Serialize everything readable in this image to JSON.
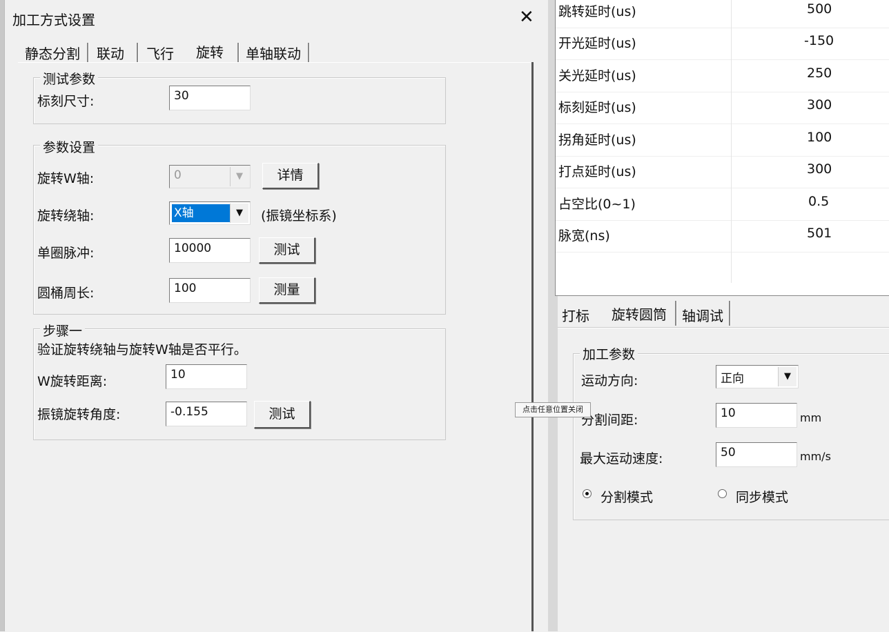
{
  "dialog": {
    "title": "加工方式设置",
    "close_glyph": "✕",
    "tabs": [
      "静态分割",
      "联动",
      "飞行",
      "旋转",
      "单轴联动"
    ],
    "test_group": {
      "legend": "测试参数",
      "mark_size_label": "标刻尺寸:",
      "mark_size_value": "30"
    },
    "param_group": {
      "legend": "参数设置",
      "w_axis_label": "旋转W轴:",
      "w_axis_value": "0",
      "details_button": "详情",
      "axis_label": "旋转绕轴:",
      "axis_value": "X轴",
      "axis_note": "(振镜坐标系)",
      "pulse_label": "单圈脉冲:",
      "pulse_value": "10000",
      "test_button": "测试",
      "circ_label": "圆桶周长:",
      "circ_value": "100",
      "measure_button": "测量"
    },
    "step_group": {
      "legend": "步骤一",
      "instruction": "验证旋转绕轴与旋转W轴是否平行。",
      "w_dist_label": "W旋转距离:",
      "w_dist_value": "10",
      "angle_label": "振镜旋转角度:",
      "angle_value": "-0.155",
      "test_button": "测试"
    }
  },
  "param_table": {
    "rows": [
      {
        "name": "跳转延时(us)",
        "value": "500"
      },
      {
        "name": "开光延时(us)",
        "value": "-150"
      },
      {
        "name": "关光延时(us)",
        "value": "250"
      },
      {
        "name": "标刻延时(us)",
        "value": "300"
      },
      {
        "name": "拐角延时(us)",
        "value": "100"
      },
      {
        "name": "打点延时(us)",
        "value": "300"
      },
      {
        "name": "占空比(0~1)",
        "value": "0.5"
      },
      {
        "name": "脉宽(ns)",
        "value": "501"
      }
    ]
  },
  "right_panel": {
    "tabs": [
      "打标",
      "旋转圆筒",
      "轴调试"
    ],
    "group_legend": "加工参数",
    "direction_label": "运动方向:",
    "direction_value": "正向",
    "spacing_label": "分割间距:",
    "spacing_value": "10",
    "spacing_unit": "mm",
    "speed_label": "最大运动速度:",
    "speed_value": "50",
    "speed_unit": "mm/s",
    "mode_split": "分割模式",
    "mode_sync": "同步模式",
    "selected_mode": "分割模式"
  },
  "tooltip": "点击任意位置关闭"
}
